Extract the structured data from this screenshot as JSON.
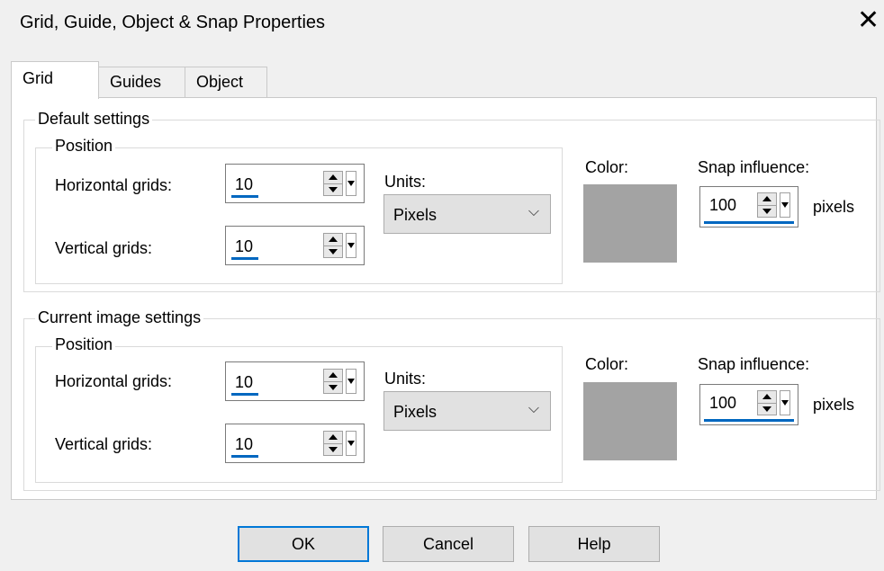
{
  "window": {
    "title": "Grid, Guide, Object & Snap Properties",
    "close_glyph": "✕"
  },
  "tabs": [
    {
      "label": "Grid"
    },
    {
      "label": "Guides"
    },
    {
      "label": "Object"
    }
  ],
  "sections": [
    {
      "label": "Default settings",
      "position_label": "Position",
      "horizontal_label": "Horizontal grids:",
      "horizontal_value": "10",
      "vertical_label": "Vertical grids:",
      "vertical_value": "10",
      "units_label": "Units:",
      "units_value": "Pixels",
      "color_label": "Color:",
      "color_value": "#a3a3a3",
      "snap_label": "Snap influence:",
      "snap_value": "100",
      "snap_unit": "pixels"
    },
    {
      "label": "Current image settings",
      "position_label": "Position",
      "horizontal_label": "Horizontal grids:",
      "horizontal_value": "10",
      "vertical_label": "Vertical grids:",
      "vertical_value": "10",
      "units_label": "Units:",
      "units_value": "Pixels",
      "color_label": "Color:",
      "color_value": "#a3a3a3",
      "snap_label": "Snap influence:",
      "snap_value": "100",
      "snap_unit": "pixels"
    }
  ],
  "buttons": {
    "ok": "OK",
    "cancel": "Cancel",
    "help": "Help"
  },
  "colors": {
    "accent": "#0078d7",
    "focus_underline": "#0067c0"
  }
}
